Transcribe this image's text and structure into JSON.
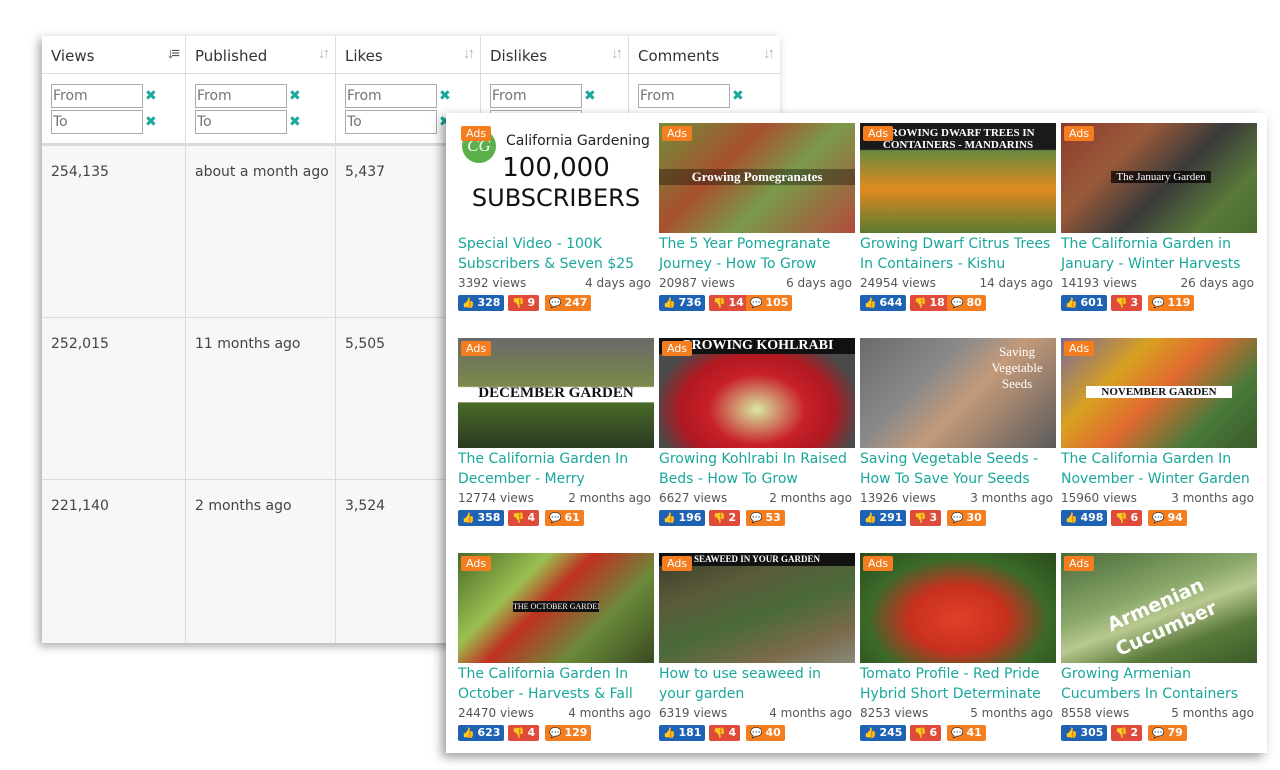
{
  "table": {
    "columns": [
      {
        "label": "Views"
      },
      {
        "label": "Published"
      },
      {
        "label": "Likes"
      },
      {
        "label": "Dislikes"
      },
      {
        "label": "Comments"
      }
    ],
    "filter": {
      "from_placeholder": "From",
      "to_placeholder": "To",
      "clear_symbol": "✖"
    },
    "rows": [
      {
        "views": "254,135",
        "published": "about a month ago",
        "likes": "5,437"
      },
      {
        "views": "252,015",
        "published": "11 months ago",
        "likes": "5,505"
      },
      {
        "views": "221,140",
        "published": "2 months ago",
        "likes": "3,524"
      }
    ]
  },
  "ad": {
    "badge": "Ads",
    "logo_text": "CG",
    "brand": "California Gardening",
    "count": "100,000",
    "unit": "SUBSCRIBERS"
  },
  "videos": [
    {
      "badge": "Ads",
      "banner": "",
      "title": "Special Video - 100K Subscribers & Seven $25",
      "views": "3392 views",
      "ago": "4 days ago",
      "likes": "328",
      "dislikes": "9",
      "comments": "247"
    },
    {
      "badge": "Ads",
      "banner": "Growing Pomegranates",
      "title": "The 5 Year Pomegranate Journey - How To Grow",
      "views": "20987 views",
      "ago": "6 days ago",
      "likes": "736",
      "dislikes": "14",
      "comments": "105"
    },
    {
      "badge": "Ads",
      "banner": "GROWING DWARF TREES IN CONTAINERS - MANDARINS",
      "title": "Growing Dwarf Citrus Trees In Containers - Kishu",
      "views": "24954 views",
      "ago": "14 days ago",
      "likes": "644",
      "dislikes": "18",
      "comments": "80"
    },
    {
      "badge": "Ads",
      "banner": "The January Garden",
      "title": "The California Garden in January - Winter Harvests",
      "views": "14193 views",
      "ago": "26 days ago",
      "likes": "601",
      "dislikes": "3",
      "comments": "119"
    },
    {
      "badge": "Ads",
      "banner": "DECEMBER GARDEN",
      "title": "The California Garden In December - Merry",
      "views": "12774 views",
      "ago": "2 months ago",
      "likes": "358",
      "dislikes": "4",
      "comments": "61"
    },
    {
      "badge": "Ads",
      "banner": "GROWING KOHLRABI",
      "title": "Growing Kohlrabi In Raised Beds - How To Grow",
      "views": "6627 views",
      "ago": "2 months ago",
      "likes": "196",
      "dislikes": "2",
      "comments": "53"
    },
    {
      "badge": "",
      "banner": "Saving Vegetable Seeds",
      "title": "Saving Vegetable Seeds - How To Save Your Seeds",
      "views": "13926 views",
      "ago": "3 months ago",
      "likes": "291",
      "dislikes": "3",
      "comments": "30"
    },
    {
      "badge": "Ads",
      "banner": "NOVEMBER GARDEN",
      "title": "The California Garden In November - Winter Garden",
      "views": "15960 views",
      "ago": "3 months ago",
      "likes": "498",
      "dislikes": "6",
      "comments": "94"
    },
    {
      "badge": "Ads",
      "banner": "THE OCTOBER GARDEN",
      "title": "The California Garden In October - Harvests & Fall",
      "views": "24470 views",
      "ago": "4 months ago",
      "likes": "623",
      "dislikes": "4",
      "comments": "129"
    },
    {
      "badge": "Ads",
      "banner": "SEAWEED IN YOUR GARDEN",
      "title": "How to use seaweed in your garden",
      "views": "6319 views",
      "ago": "4 months ago",
      "likes": "181",
      "dislikes": "4",
      "comments": "40"
    },
    {
      "badge": "Ads",
      "banner": "",
      "title": "Tomato Profile - Red Pride Hybrid Short Determinate",
      "views": "8253 views",
      "ago": "5 months ago",
      "likes": "245",
      "dislikes": "6",
      "comments": "41"
    },
    {
      "badge": "Ads",
      "banner": "Armenian Cucumber",
      "title": "Growing Armenian Cucumbers In Containers",
      "views": "8558 views",
      "ago": "5 months ago",
      "likes": "305",
      "dislikes": "2",
      "comments": "79"
    }
  ],
  "icons": {
    "like": "thumbs-up-icon",
    "dislike": "thumbs-down-icon",
    "comment": "comment-icon"
  },
  "colors": {
    "accent": "#1aa79b",
    "like": "#1e63b3",
    "dislike": "#e04a3a",
    "comment": "#f37d1f"
  }
}
